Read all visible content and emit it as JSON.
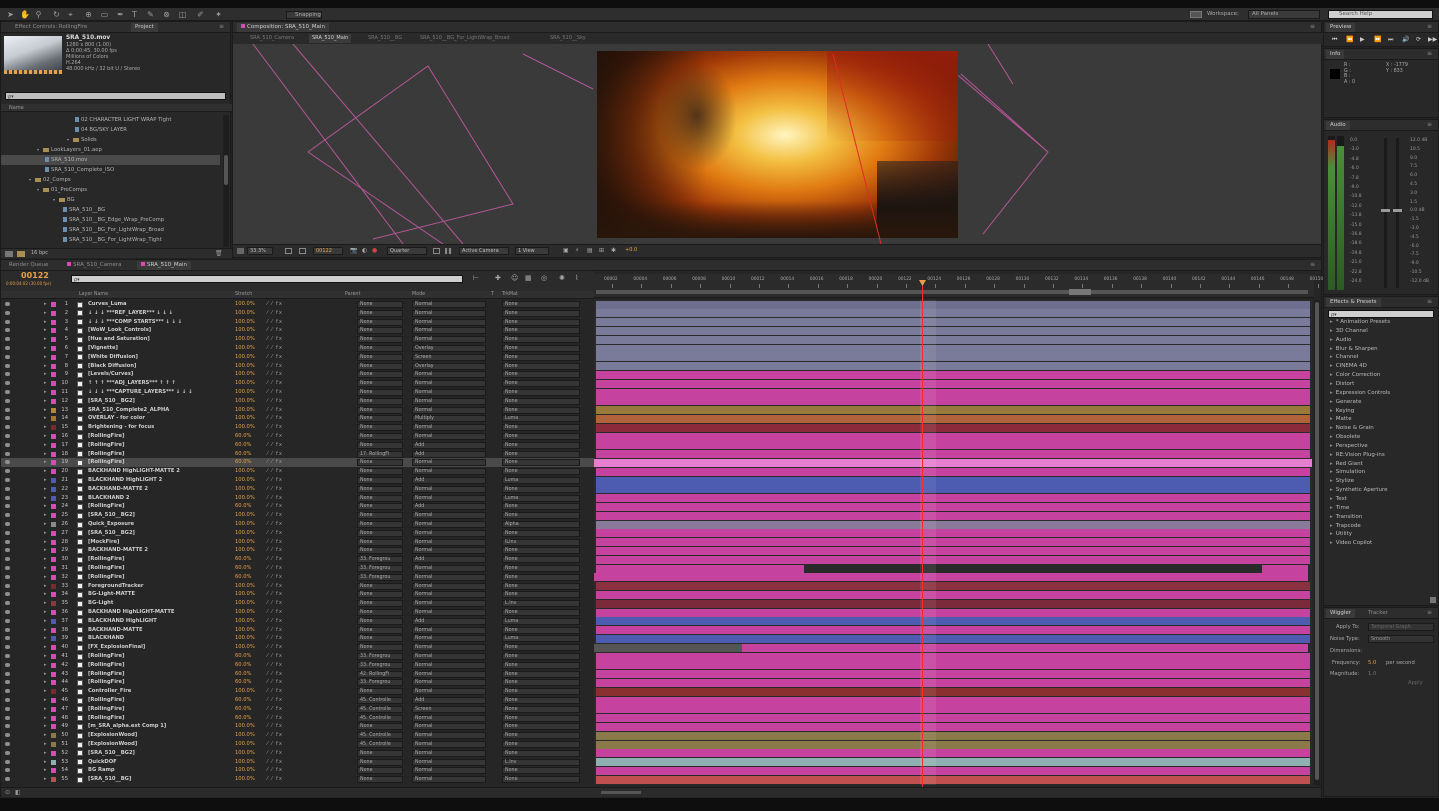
{
  "colors": {
    "accent": "#e6a04a",
    "label_pink": "#d94bb0",
    "playhead": "#ff2a2a"
  },
  "toolbar": {
    "snapping_label": "Snapping",
    "workspace_label": "Workspace:",
    "workspace_value": "All Panels",
    "search_placeholder": "Search Help"
  },
  "project": {
    "tabs": [
      "Effect Controls: RollingFire",
      "Project"
    ],
    "asset_name": "SRA_510.mov",
    "asset_info": [
      "1280 x 800 (1.00)",
      "Δ 0;00;45, 30.00 fps",
      "Millions of Colors",
      "H.264",
      "48.000 kHz / 32 bit U / Stereo"
    ],
    "search_placeholder": "ρ▾",
    "col_name": "Name",
    "tree": [
      {
        "label": "02 CHARACTER LIGHT WRAP Tight",
        "indent": 74,
        "type": "comp",
        "sel": false
      },
      {
        "label": "04 BG/SKY LAYER",
        "indent": 74,
        "type": "comp",
        "sel": false
      },
      {
        "label": "Solids",
        "indent": 66,
        "type": "folder",
        "sel": false
      },
      {
        "label": "LookLayers_01.aep",
        "indent": 36,
        "type": "folder",
        "sel": false
      },
      {
        "label": "SRA_510.mov",
        "indent": 44,
        "type": "comp",
        "sel": true
      },
      {
        "label": "SRA_510_Complete_ISO",
        "indent": 44,
        "type": "comp",
        "sel": false
      },
      {
        "label": "02_Comps",
        "indent": 28,
        "type": "folder",
        "sel": false
      },
      {
        "label": "01_PreComps",
        "indent": 36,
        "type": "folder",
        "sel": false
      },
      {
        "label": "BG",
        "indent": 52,
        "type": "folder",
        "sel": false
      },
      {
        "label": "SRA_510__BG",
        "indent": 62,
        "type": "comp",
        "sel": false
      },
      {
        "label": "SRA_510__BG_Edge_Wrap_PreComp",
        "indent": 62,
        "type": "comp",
        "sel": false
      },
      {
        "label": "SRA_510__BG_For_LightWrap_Broad",
        "indent": 62,
        "type": "comp",
        "sel": false
      },
      {
        "label": "SRA_510__BG_For_LightWrap_Tight",
        "indent": 62,
        "type": "comp",
        "sel": false
      }
    ],
    "bpc": "16 bpc"
  },
  "composition": {
    "panel_tab": "Composition: SRA_510_Main",
    "view_tabs": [
      "SRA_510_Camera",
      "SRA_510_Main",
      "SRA_510__BG",
      "SRA_510__BG_For_LightWrap_Broad",
      "SRA_510__Sky"
    ],
    "zoom": "33.3%",
    "timecode": "00122",
    "resolution": "Quarter",
    "camera": "Active Camera",
    "views": "1 View",
    "exposure": "+0.0"
  },
  "timeline": {
    "tabs": [
      "Render Queue",
      "SRA_510_Camera",
      "SRA_510_Main"
    ],
    "timecode": "00122",
    "timecode_sub": "0:00:04:02 (30.00 fps)",
    "search_placeholder": "ρ▾",
    "headers": {
      "layer_name": "Layer Name",
      "stretch": "Stretch",
      "parent": "Parent",
      "mode": "Mode",
      "t": "T",
      "trkmat": "TrkMat"
    },
    "ruler": [
      "00002",
      "00004",
      "00006",
      "00008",
      "00010",
      "00012",
      "00014",
      "00016",
      "00018",
      "00020",
      "00122",
      "00124",
      "00126",
      "00128",
      "00130",
      "00132",
      "00134",
      "00136",
      "00138",
      "00140",
      "00142",
      "00144",
      "00146",
      "00148",
      "00150"
    ],
    "layers": [
      {
        "n": "1",
        "name": "Curves_Luma",
        "stretch": "100.0%",
        "parent": "None",
        "mode": "Normal",
        "trk": "None"
      },
      {
        "n": "2",
        "name": "↓ ↓ ↓ ***REF_LAYER*** ↓ ↓ ↓",
        "stretch": "100.0%",
        "parent": "None",
        "mode": "Normal",
        "trk": "None"
      },
      {
        "n": "3",
        "name": "↓ ↓ ↓ ***COMP STARTS*** ↓ ↓ ↓",
        "stretch": "100.0%",
        "parent": "None",
        "mode": "Normal",
        "trk": "None"
      },
      {
        "n": "4",
        "name": "[WoW_Look_Controls]",
        "stretch": "100.0%",
        "parent": "None",
        "mode": "Normal",
        "trk": "None"
      },
      {
        "n": "5",
        "name": "[Hue and Saturation]",
        "stretch": "100.0%",
        "parent": "None",
        "mode": "Normal",
        "trk": "None"
      },
      {
        "n": "6",
        "name": "[Vignette]",
        "stretch": "100.0%",
        "parent": "None",
        "mode": "Overlay",
        "trk": "None"
      },
      {
        "n": "7",
        "name": "[White Diffusion]",
        "stretch": "100.0%",
        "parent": "None",
        "mode": "Screen",
        "trk": "None"
      },
      {
        "n": "8",
        "name": "[Black Diffusion]",
        "stretch": "100.0%",
        "parent": "None",
        "mode": "Overlay",
        "trk": "None"
      },
      {
        "n": "9",
        "name": "[Levels/Curves]",
        "stretch": "100.0%",
        "parent": "None",
        "mode": "Normal",
        "trk": "None"
      },
      {
        "n": "10",
        "name": "↑ ↑ ↑ ***ADJ_LAYERS*** ↑ ↑ ↑",
        "stretch": "100.0%",
        "parent": "None",
        "mode": "Normal",
        "trk": "None"
      },
      {
        "n": "11",
        "name": "↓ ↓ ↓ ***CAPTURE_LAYERS*** ↓ ↓ ↓",
        "stretch": "100.0%",
        "parent": "None",
        "mode": "Normal",
        "trk": "None"
      },
      {
        "n": "12",
        "name": "[SRA_510__BG2]",
        "stretch": "100.0%",
        "parent": "None",
        "mode": "Normal",
        "trk": "None"
      },
      {
        "n": "13",
        "name": "SRA_510_Complete2_ALPHA",
        "stretch": "100.0%",
        "parent": "None",
        "mode": "Normal",
        "trk": "None"
      },
      {
        "n": "14",
        "name": "OVERLAY - for color",
        "stretch": "100.0%",
        "parent": "None",
        "mode": "Multiply",
        "trk": "Luma"
      },
      {
        "n": "15",
        "name": "Brightening - for focus",
        "stretch": "100.0%",
        "parent": "None",
        "mode": "Normal",
        "trk": "None"
      },
      {
        "n": "16",
        "name": "[RollingFire]",
        "stretch": "60.0%",
        "parent": "None",
        "mode": "Normal",
        "trk": "None"
      },
      {
        "n": "17",
        "name": "[RollingFire]",
        "stretch": "60.0%",
        "parent": "None",
        "mode": "Add",
        "trk": "None"
      },
      {
        "n": "18",
        "name": "[RollingFire]",
        "stretch": "60.0%",
        "parent": "17. RollingFi",
        "mode": "Add",
        "trk": "None"
      },
      {
        "n": "19",
        "name": "[RollingFire]",
        "stretch": "60.0%",
        "parent": "None",
        "mode": "Normal",
        "trk": "None"
      },
      {
        "n": "20",
        "name": "BACKHAND HighLIGHT-MATTE 2",
        "stretch": "100.0%",
        "parent": "None",
        "mode": "Normal",
        "trk": "None"
      },
      {
        "n": "21",
        "name": "BLACKHAND HighLIGHT 2",
        "stretch": "100.0%",
        "parent": "None",
        "mode": "Add",
        "trk": "Luma"
      },
      {
        "n": "22",
        "name": "BACKHAND-MATTE 2",
        "stretch": "100.0%",
        "parent": "None",
        "mode": "Normal",
        "trk": "None"
      },
      {
        "n": "23",
        "name": "BLACKHAND 2",
        "stretch": "100.0%",
        "parent": "None",
        "mode": "Normal",
        "trk": "Luma"
      },
      {
        "n": "24",
        "name": "[RollingFire]",
        "stretch": "60.0%",
        "parent": "None",
        "mode": "Add",
        "trk": "None"
      },
      {
        "n": "25",
        "name": "[SRA_510__BG2]",
        "stretch": "100.0%",
        "parent": "None",
        "mode": "Normal",
        "trk": "None"
      },
      {
        "n": "26",
        "name": "Quick_Exposure",
        "stretch": "100.0%",
        "parent": "None",
        "mode": "Normal",
        "trk": "Alpha"
      },
      {
        "n": "27",
        "name": "[SRA_510__BG2]",
        "stretch": "100.0%",
        "parent": "None",
        "mode": "Normal",
        "trk": "None"
      },
      {
        "n": "28",
        "name": "[MockFire]",
        "stretch": "100.0%",
        "parent": "None",
        "mode": "Normal",
        "trk": "ILInv"
      },
      {
        "n": "29",
        "name": "BACKHAND-MATTE 2",
        "stretch": "100.0%",
        "parent": "None",
        "mode": "Normal",
        "trk": "None"
      },
      {
        "n": "30",
        "name": "[RollingFire]",
        "stretch": "60.0%",
        "parent": "33. Foregrou",
        "mode": "Add",
        "trk": "None"
      },
      {
        "n": "31",
        "name": "[RollingFire]",
        "stretch": "60.0%",
        "parent": "33. Foregrou",
        "mode": "Normal",
        "trk": "None"
      },
      {
        "n": "32",
        "name": "[RollingFire]",
        "stretch": "60.0%",
        "parent": "33. Foregrou",
        "mode": "Normal",
        "trk": "None"
      },
      {
        "n": "33",
        "name": "ForegroundTracker",
        "stretch": "100.0%",
        "parent": "None",
        "mode": "Normal",
        "trk": "None"
      },
      {
        "n": "34",
        "name": "BG-Light-MATTE",
        "stretch": "100.0%",
        "parent": "None",
        "mode": "Normal",
        "trk": "None"
      },
      {
        "n": "35",
        "name": "BG-Light",
        "stretch": "100.0%",
        "parent": "None",
        "mode": "Normal",
        "trk": "L.Inv"
      },
      {
        "n": "36",
        "name": "BACKHAND HighLIGHT-MATTE",
        "stretch": "100.0%",
        "parent": "None",
        "mode": "Normal",
        "trk": "None"
      },
      {
        "n": "37",
        "name": "BLACKHAND HighLIGHT",
        "stretch": "100.0%",
        "parent": "None",
        "mode": "Add",
        "trk": "Luma"
      },
      {
        "n": "38",
        "name": "BACKHAND-MATTE",
        "stretch": "100.0%",
        "parent": "None",
        "mode": "Normal",
        "trk": "None"
      },
      {
        "n": "39",
        "name": "BLACKHAND",
        "stretch": "100.0%",
        "parent": "None",
        "mode": "Normal",
        "trk": "Luma"
      },
      {
        "n": "40",
        "name": "[FX_ExplosionFinal]",
        "stretch": "100.0%",
        "parent": "None",
        "mode": "Normal",
        "trk": "None"
      },
      {
        "n": "41",
        "name": "[RollingFire]",
        "stretch": "60.0%",
        "parent": "33. Foregrou",
        "mode": "Normal",
        "trk": "None"
      },
      {
        "n": "42",
        "name": "[RollingFire]",
        "stretch": "60.0%",
        "parent": "33. Foregrou",
        "mode": "Normal",
        "trk": "None"
      },
      {
        "n": "43",
        "name": "[RollingFire]",
        "stretch": "60.0%",
        "parent": "42. RollingFi",
        "mode": "Normal",
        "trk": "None"
      },
      {
        "n": "44",
        "name": "[RollingFire]",
        "stretch": "60.0%",
        "parent": "33. Foregrou",
        "mode": "Normal",
        "trk": "None"
      },
      {
        "n": "45",
        "name": "Controller_Fire",
        "stretch": "100.0%",
        "parent": "None",
        "mode": "Normal",
        "trk": "None"
      },
      {
        "n": "46",
        "name": "[RollingFire]",
        "stretch": "60.0%",
        "parent": "45. Controlle",
        "mode": "Add",
        "trk": "None"
      },
      {
        "n": "47",
        "name": "[RollingFire]",
        "stretch": "60.0%",
        "parent": "45. Controlle",
        "mode": "Screen",
        "trk": "None"
      },
      {
        "n": "48",
        "name": "[RollingFire]",
        "stretch": "60.0%",
        "parent": "45. Controlle",
        "mode": "Normal",
        "trk": "None"
      },
      {
        "n": "49",
        "name": "[m_SRA_alpha.ext Comp 1]",
        "stretch": "100.0%",
        "parent": "None",
        "mode": "Normal",
        "trk": "None"
      },
      {
        "n": "50",
        "name": "[ExplosionWood]",
        "stretch": "100.0%",
        "parent": "45. Controlle",
        "mode": "Normal",
        "trk": "None"
      },
      {
        "n": "51",
        "name": "[ExplosionWood]",
        "stretch": "100.0%",
        "parent": "45. Controlle",
        "mode": "Normal",
        "trk": "None"
      },
      {
        "n": "52",
        "name": "[SRA_510__BG2]",
        "stretch": "100.0%",
        "parent": "None",
        "mode": "Normal",
        "trk": "None"
      },
      {
        "n": "53",
        "name": "QuickDOF",
        "stretch": "100.0%",
        "parent": "None",
        "mode": "Normal",
        "trk": "L.Inv"
      },
      {
        "n": "54",
        "name": "BG Ramp",
        "stretch": "100.0%",
        "parent": "None",
        "mode": "Normal",
        "trk": "None"
      },
      {
        "n": "55",
        "name": "[SRA_510__BG]",
        "stretch": "100.0%",
        "parent": "None",
        "mode": "Normal",
        "trk": "None"
      }
    ]
  },
  "preview": {
    "title": "Preview"
  },
  "info": {
    "title": "Info",
    "r": "R :",
    "g": "G :",
    "b": "B :",
    "a": "A : 0",
    "x": "X : -1779",
    "y": "Y : 833"
  },
  "audio": {
    "title": "Audio",
    "left_scale": [
      "0.0",
      "-3.0",
      "-4.8",
      "-6.0",
      "-7.8",
      "-9.0",
      "-10.8",
      "-12.0",
      "-13.8",
      "-15.0",
      "-16.8",
      "-18.0",
      "-19.8",
      "-21.0",
      "-22.8",
      "-24.0"
    ],
    "right_scale": [
      "12.0 dB",
      "10.5",
      "9.0",
      "7.5",
      "6.0",
      "4.5",
      "3.0",
      "1.5",
      "0.0 dB",
      "-1.5",
      "-3.0",
      "-4.5",
      "-6.0",
      "-7.5",
      "-9.0",
      "-10.5",
      "-12.0 dB"
    ]
  },
  "effects": {
    "title": "Effects & Presets",
    "search_placeholder": "ρ▾",
    "items": [
      "* Animation Presets",
      "3D Channel",
      "Audio",
      "Blur & Sharpen",
      "Channel",
      "CINEMA 4D",
      "Color Correction",
      "Distort",
      "Expression Controls",
      "Generate",
      "Keying",
      "Matte",
      "Noise & Grain",
      "Obsolete",
      "Perspective",
      "RE:Vision Plug-ins",
      "Red Giant",
      "Simulation",
      "Stylize",
      "Synthetic Aperture",
      "Text",
      "Time",
      "Transition",
      "Trapcode",
      "Utility",
      "Video Copilot"
    ]
  },
  "wiggler": {
    "tabs": [
      "Wiggler",
      "Tracker"
    ],
    "apply_to_label": "Apply To:",
    "apply_to_value": "Temporal Graph",
    "noise_label": "Noise Type:",
    "noise_value": "Smooth",
    "dimensions_label": "Dimensions:",
    "frequency_label": "Frequency:",
    "frequency_value": "5.0",
    "per_second": "per second",
    "magnitude_label": "Magnitude:",
    "magnitude_value": "1.0",
    "apply_button": "Apply"
  }
}
